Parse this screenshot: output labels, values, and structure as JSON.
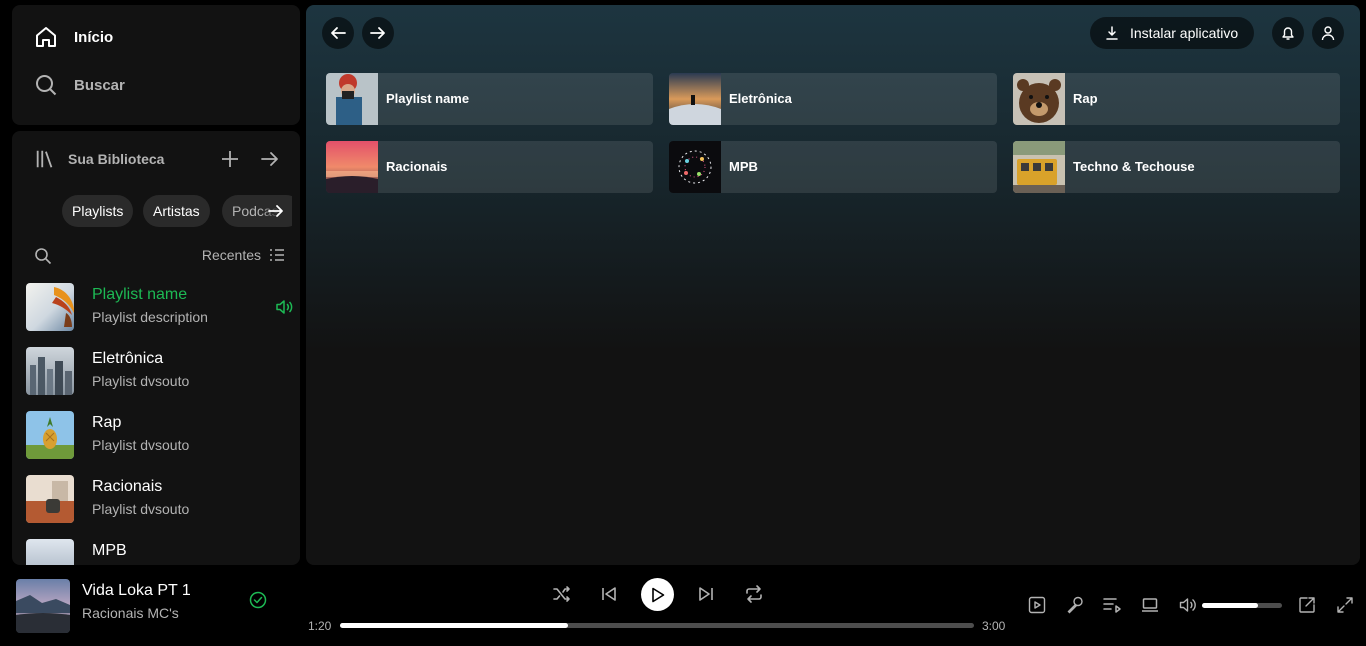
{
  "nav": {
    "home_label": "Início",
    "search_label": "Buscar"
  },
  "library": {
    "title": "Sua Biblioteca",
    "chips": [
      "Playlists",
      "Artistas",
      "Podcasts"
    ],
    "sort_label": "Recentes",
    "items": [
      {
        "title": "Playlist name",
        "subtitle": "Playlist description",
        "playing": true
      },
      {
        "title": "Eletrônica",
        "subtitle": "Playlist dvsouto"
      },
      {
        "title": "Rap",
        "subtitle": "Playlist dvsouto"
      },
      {
        "title": "Racionais",
        "subtitle": "Playlist dvsouto"
      },
      {
        "title": "MPB",
        "subtitle": ""
      }
    ]
  },
  "header": {
    "install_label": "Instalar aplicativo"
  },
  "quick_picks": [
    {
      "label": "Playlist name"
    },
    {
      "label": "Eletrônica"
    },
    {
      "label": "Rap"
    },
    {
      "label": "Racionais"
    },
    {
      "label": "MPB"
    },
    {
      "label": "Techno & Techouse"
    }
  ],
  "player": {
    "track_title": "Vida Loka PT 1",
    "artist": "Racionais MC's",
    "current_time": "1:20",
    "total_time": "3:00",
    "progress_fraction": 0.36,
    "volume_fraction": 0.7
  },
  "colors": {
    "accent": "#1db954",
    "panel": "#121212",
    "header_gradient_top": "#1d3540"
  },
  "icons": {
    "home": "home-icon",
    "search": "search-icon",
    "library": "library-icon",
    "plus": "plus-icon",
    "arrow_right": "arrow-right-icon",
    "speaker": "speaker-icon",
    "bell": "bell-icon",
    "user": "user-icon",
    "download": "download-icon",
    "shuffle": "shuffle-icon",
    "previous": "previous-icon",
    "play": "play-icon",
    "next": "next-icon",
    "repeat": "repeat-icon",
    "check": "check-circle-icon",
    "lyrics": "microphone-icon",
    "queue": "queue-icon",
    "device": "device-icon",
    "volume": "volume-icon",
    "mini_player": "mini-player-icon",
    "fullscreen": "fullscreen-icon"
  }
}
